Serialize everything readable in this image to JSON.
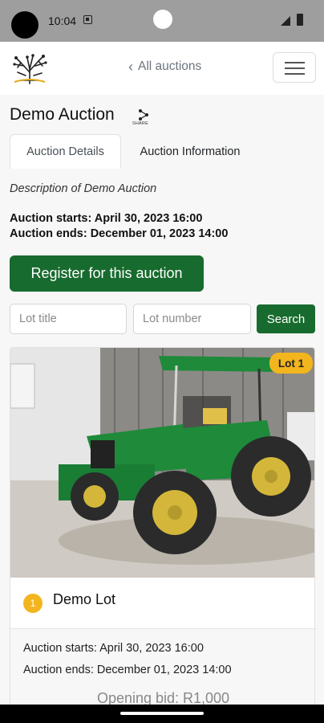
{
  "status_bar": {
    "time": "10:04"
  },
  "header": {
    "back_label": "All auctions",
    "logo_icon": "tree-logo-icon",
    "menu_icon": "hamburger-menu-icon"
  },
  "auction": {
    "title": "Demo Auction",
    "share_label": "SHARE",
    "tabs": [
      {
        "label": "Auction Details",
        "active": true
      },
      {
        "label": "Auction Information",
        "active": false
      }
    ],
    "description": "Description of Demo Auction",
    "starts": "Auction starts: April 30, 2023 16:00",
    "ends": "Auction ends: December 01, 2023 14:00",
    "register_label": "Register for this auction"
  },
  "search": {
    "lot_title_placeholder": "Lot title",
    "lot_number_placeholder": "Lot number",
    "button_label": "Search"
  },
  "lots": [
    {
      "badge": "Lot 1",
      "number": "1",
      "name": "Demo Lot",
      "starts": "Auction starts: April 30, 2023 16:00",
      "ends": "Auction ends: December 01, 2023 14:00",
      "opening_bid": "Opening bid: R1,000"
    }
  ],
  "colors": {
    "primary": "#186b2e",
    "badge": "#f3b51e",
    "tractor": "#1e8a3a"
  }
}
